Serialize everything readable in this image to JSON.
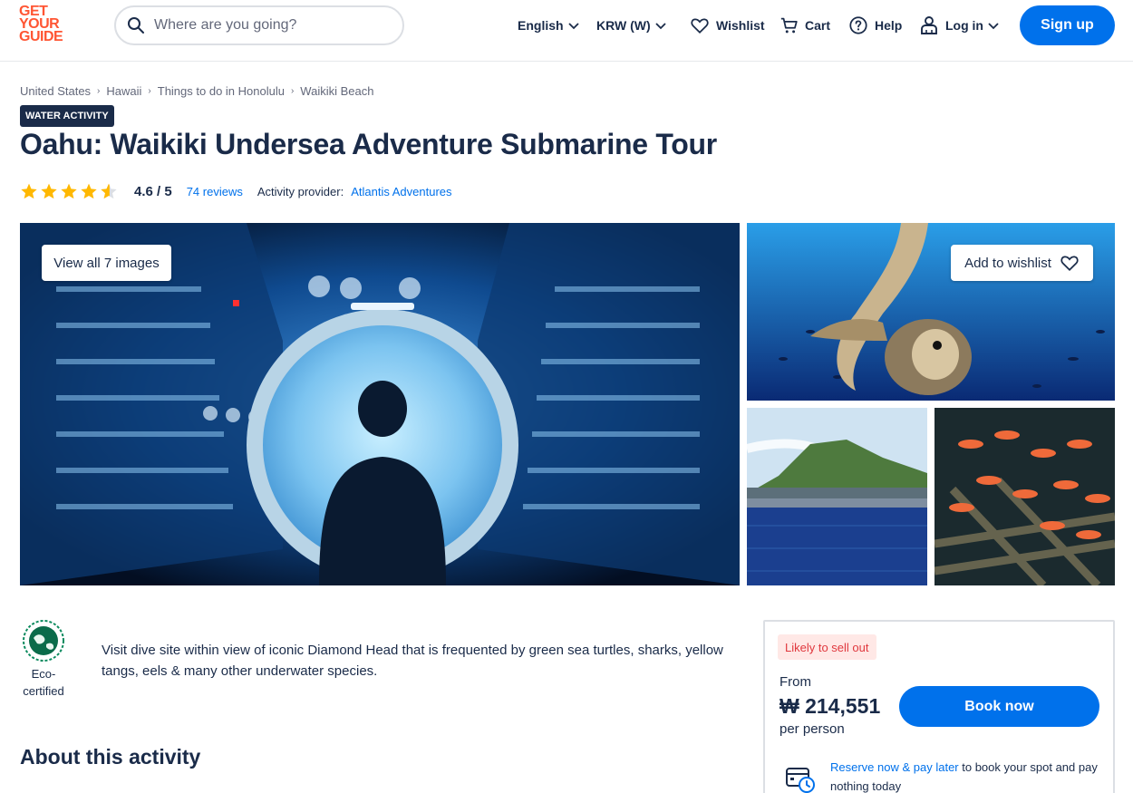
{
  "header": {
    "logo_lines": [
      "GET",
      "YOUR",
      "GUIDE"
    ],
    "search_placeholder": "Where are you going?",
    "language": "English",
    "currency": "KRW (W)",
    "wishlist": "Wishlist",
    "cart": "Cart",
    "help": "Help",
    "login": "Log in",
    "signup": "Sign up"
  },
  "breadcrumb": [
    "United States",
    "Hawaii",
    "Things to do in Honolulu",
    "Waikiki Beach"
  ],
  "category_badge": "WATER ACTIVITY",
  "title": "Oahu: Waikiki Undersea Adventure Submarine Tour",
  "rating": {
    "stars": 4.6,
    "score_text": "4.6 / 5",
    "reviews_text": "74 reviews",
    "provider_label": "Activity provider:",
    "provider_name": "Atlantis Adventures"
  },
  "gallery": {
    "view_all": "View all 7 images",
    "add_wishlist": "Add to wishlist"
  },
  "eco": {
    "line1": "Eco-",
    "line2": "certified"
  },
  "highlight": "Visit dive site within view of iconic Diamond Head that is frequented by green sea turtles, sharks, yellow tangs, eels & many other underwater species.",
  "about_heading": "About this activity",
  "booking": {
    "badge": "Likely to sell out",
    "from": "From",
    "price": "₩ 214,551",
    "per_person": "per person",
    "book_now": "Book now",
    "reserve_link": "Reserve now & pay later",
    "reserve_text": " to book your spot and pay nothing today"
  },
  "colors": {
    "brand": "#ff5533",
    "primary": "#0071eb",
    "text": "#1a2b49",
    "star": "#ffb800"
  }
}
